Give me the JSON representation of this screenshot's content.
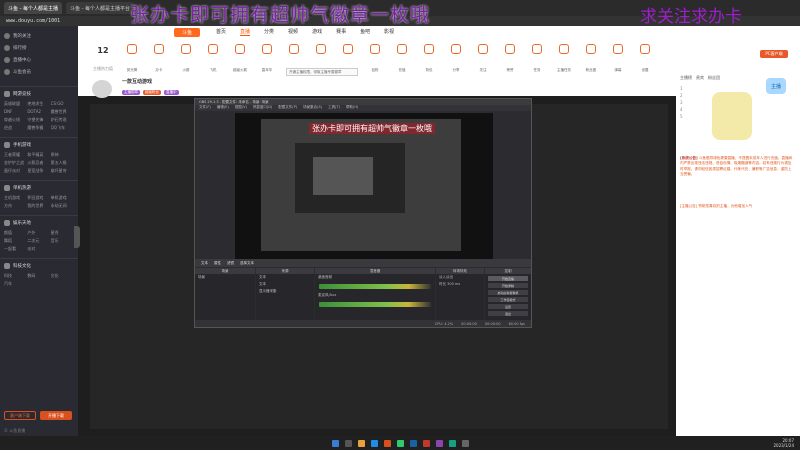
{
  "browser": {
    "tabs": [
      "斗鱼 - 每个人都是主播",
      "斗鱼 - 每个人都是主播平台"
    ],
    "url": "www.douyu.com/1001"
  },
  "overlays": {
    "main_text": "张办卡即可拥有超帅气徽章一枚哦",
    "side_text": "求关注求办卡"
  },
  "sidebar": {
    "top_items": [
      "我的关注",
      "排行榜",
      "直播中心",
      "斗鱼会员"
    ],
    "sections": [
      {
        "title": "网游竞技",
        "items": [
          "英雄联盟",
          "绝地求生",
          "CS:GO",
          "DNF",
          "DOTA2",
          "魔兽世界",
          "穿越火线",
          "守望先锋",
          "炉石传说",
          "逆战",
          "魔兽争霸",
          "QQ飞车"
        ]
      },
      {
        "title": "手机游戏",
        "items": [
          "王者荣耀",
          "和平精英",
          "原神",
          "金铲铲之战",
          "火影忍者",
          "第五人格",
          "蛋仔派对",
          "皇室战争",
          "崩坏星穹"
        ]
      },
      {
        "title": "单机热游",
        "items": [
          "主机游戏",
          "怀旧游戏",
          "单机游戏",
          "方舟",
          "我的世界",
          "永劫无间"
        ]
      },
      {
        "title": "娱乐天地",
        "items": [
          "颜值",
          "户外",
          "星秀",
          "舞蹈",
          "二次元",
          "音乐",
          "一起看",
          "派对"
        ]
      },
      {
        "title": "科技文化",
        "items": [
          "科技",
          "数码",
          "文化",
          "汽车"
        ]
      }
    ],
    "buttons": [
      "客户端下载",
      "开播下载"
    ],
    "footer": "© 斗鱼直播"
  },
  "site_nav": {
    "logo": "斗鱼",
    "links": [
      "首页",
      "直播",
      "分类",
      "视频",
      "游戏",
      "赛事",
      "鱼吧",
      "影视"
    ],
    "active_index": 1
  },
  "room": {
    "hot_value": "12",
    "hot_label": "主播热力值",
    "gifts": [
      "荧光棒",
      "办卡",
      "火箭",
      "飞机",
      "超级火箭",
      "嘉年华",
      "主播徽章",
      "礼物墙",
      "特权",
      "钻粉",
      "充值",
      "背包",
      "分享",
      "关注",
      "荣誉",
      "任务",
      "主播任务",
      "粉丝团",
      "弹幕",
      "设置"
    ],
    "pc_button": "PC客户端",
    "tip": "开通主播权限，领取主播专属徽章",
    "title": "一款互动游戏",
    "tags": [
      "主播勋章",
      "超级粉丝",
      "直播中"
    ]
  },
  "obs": {
    "title": "OBS 29.1.3 - 配置文件: 未命名 - 场景: 场景",
    "menu": [
      "文件(F)",
      "编辑(E)",
      "视图(V)",
      "停靠窗口(D)",
      "配置文件(P)",
      "场景集合(S)",
      "工具(T)",
      "帮助(H)"
    ],
    "preview_overlay": "张办卡即可拥有超帅气徽章一枚哦",
    "toolbar": [
      "文本",
      "属性",
      "滤镜",
      "选择文本"
    ],
    "docks": {
      "scenes": {
        "title": "场景",
        "items": [
          "场景"
        ]
      },
      "sources": {
        "title": "来源",
        "items": [
          "文本",
          "文本",
          "显示器采集"
        ]
      },
      "mixer": {
        "title": "混音器",
        "items": [
          "桌面音频",
          "麦克风/Aux"
        ]
      },
      "transitions": {
        "title": "转场特效",
        "items": [
          "淡入淡出",
          "时长 300 ms"
        ]
      },
      "controls": {
        "title": "控制",
        "items": [
          "开始直播",
          "开始录制",
          "启动虚拟摄像机",
          "工作室模式",
          "设置",
          "退出"
        ]
      }
    },
    "status": [
      "CPU: 4.2%",
      "00:00:00",
      "00:00:00",
      "60.00 fps"
    ]
  },
  "right_panel": {
    "tabs": [
      "主播榜",
      "贵宾",
      "粉丝团"
    ],
    "ranks": [
      "1",
      "2",
      "3",
      "4",
      "5"
    ],
    "mascot_tag": "主播",
    "notice_label": "[系统公告]",
    "notice": "斗鱼倡导绿色健康直播，不提倡未成年人进行充值。直播间内严禁出现违法违规、低俗色情、吸烟酗酒等内容，若有违规行为请及时举报。请勿轻信各类招聘征婚、代练代充、兼职等广告信息，谨防上当受骗。",
    "link": "[主播公告] 赞助您喜欢的主播，为他增加人气"
  },
  "taskbar": {
    "time": "20:07",
    "date": "2023/1/24",
    "icon_colors": [
      "#3a7bd5",
      "#555",
      "#e6a23c",
      "#1f8ce6",
      "#d9501f",
      "#2ecc71",
      "#1b5fa6",
      "#c0392b",
      "#8e44ad",
      "#16a085",
      "#666"
    ]
  }
}
